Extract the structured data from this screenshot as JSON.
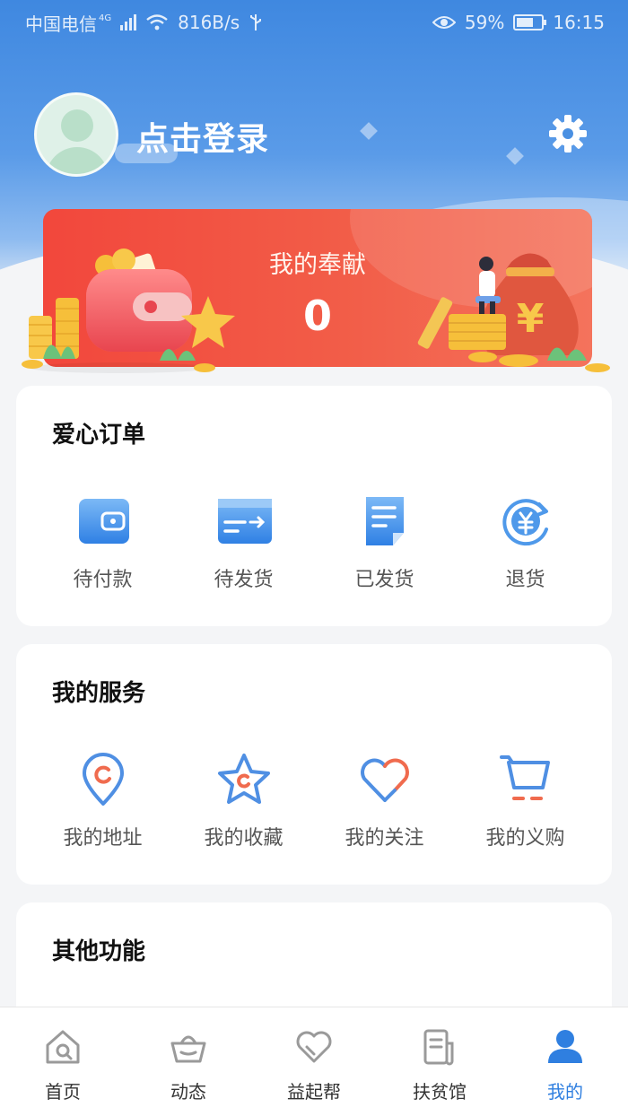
{
  "status_bar": {
    "carrier": "中国电信",
    "network_badge": "4G",
    "speed": "816B/s",
    "battery": "59%",
    "time": "16:15"
  },
  "profile": {
    "login_label": "点击登录",
    "avatar_icon": "user-avatar-icon",
    "settings_icon": "gear-icon"
  },
  "contribution": {
    "title": "我的奉献",
    "value": "0"
  },
  "orders": {
    "title": "爱心订单",
    "items": [
      {
        "label": "待付款",
        "icon": "wallet-icon"
      },
      {
        "label": "待发货",
        "icon": "shipping-box-icon"
      },
      {
        "label": "已发货",
        "icon": "document-icon"
      },
      {
        "label": "退货",
        "icon": "refund-icon"
      }
    ]
  },
  "services": {
    "title": "我的服务",
    "items": [
      {
        "label": "我的地址",
        "icon": "location-pin-icon"
      },
      {
        "label": "我的收藏",
        "icon": "star-icon"
      },
      {
        "label": "我的关注",
        "icon": "heart-icon"
      },
      {
        "label": "我的义购",
        "icon": "cart-icon"
      }
    ]
  },
  "other": {
    "title": "其他功能"
  },
  "nav": {
    "active_color": "#2f7fe0",
    "items": [
      {
        "label": "首页",
        "icon": "home-icon"
      },
      {
        "label": "动态",
        "icon": "basket-icon"
      },
      {
        "label": "益起帮",
        "icon": "heart-outline-icon"
      },
      {
        "label": "扶贫馆",
        "icon": "document-stack-icon"
      },
      {
        "label": "我的",
        "icon": "person-icon"
      }
    ]
  }
}
